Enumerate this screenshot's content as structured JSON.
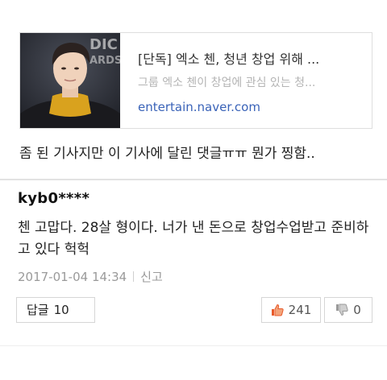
{
  "article_card": {
    "title": "[단독] 엑소 첸, 청년 창업 위해 ...",
    "description": "그룹 엑소 첸이 창업에 관심 있는 청...",
    "url": "entertain.naver.com",
    "thumbnail_icon": "person-photo-icon",
    "thumbnail_backdrop_text": "DIC\nARDS"
  },
  "caption": "좀 된 기사지만 이 기사에 달린 댓글ㅠㅠ 뭔가 찡함..",
  "comment": {
    "username": "kyb0****",
    "text": "첸 고맙다. 28살 형이다. 너가 낸 돈으로 창업수업받고 준비하고 있다 헉헉",
    "timestamp": "2017-01-04 14:34",
    "report_label": "신고",
    "reply_label": "답글",
    "reply_count": "10",
    "like_count": "241",
    "dislike_count": "0",
    "like_icon": "thumbs-up-icon",
    "dislike_icon": "thumbs-down-icon",
    "like_color": "#e85a2a"
  }
}
